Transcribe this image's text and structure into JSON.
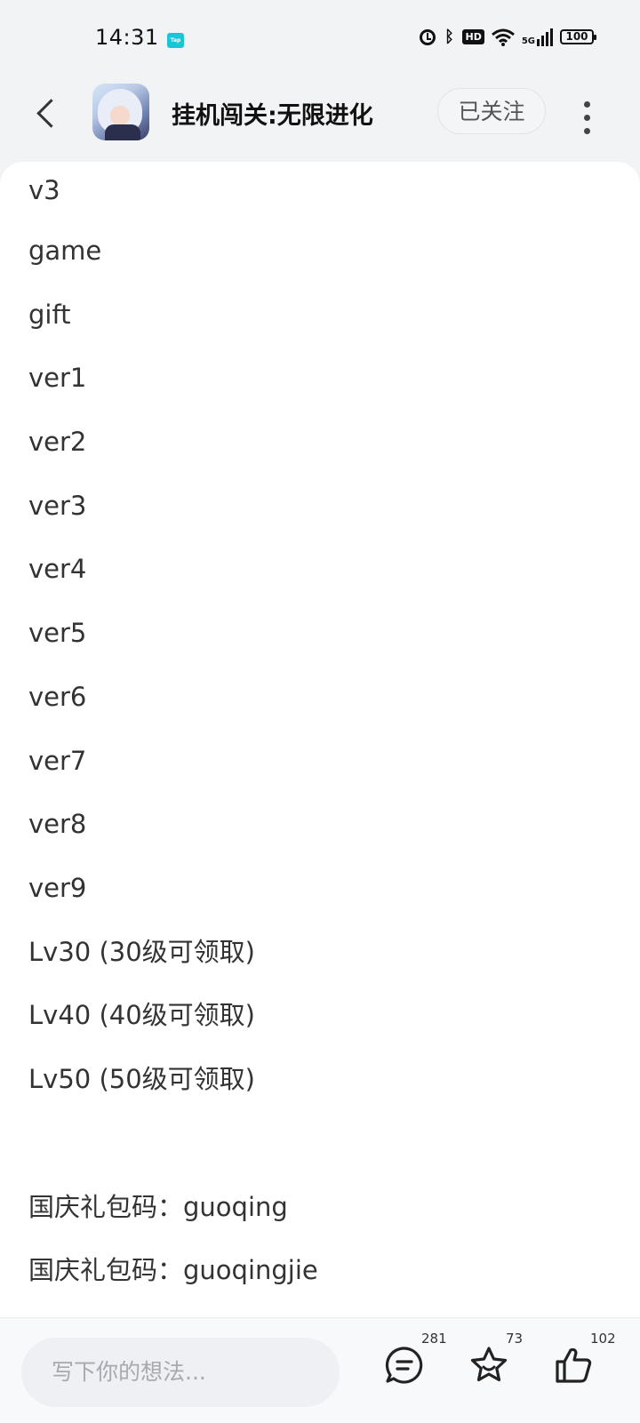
{
  "status_bar": {
    "time": "14:31",
    "tap_label": "Tap",
    "hd_label": "HD",
    "signal_label": "5G",
    "battery": "100"
  },
  "header": {
    "title": "挂机闯关:无限进化",
    "follow_label": "已关注"
  },
  "content": {
    "lines": [
      "v3",
      "game",
      "gift",
      "ver1",
      "ver2",
      "ver3",
      "ver4",
      "ver5",
      "ver6",
      "ver7",
      "ver8",
      "ver9",
      "Lv30 (30级可领取)",
      "Lv40 (40级可领取)",
      "Lv50 (50级可领取)"
    ],
    "codes": [
      "国庆礼包码：guoqing",
      "国庆礼包码：guoqingjie"
    ]
  },
  "bottom_bar": {
    "input_placeholder": "写下你的想法...",
    "comment_count": "281",
    "favorite_count": "73",
    "like_count": "102"
  },
  "colors": {
    "background": "#f2f3f5",
    "content_bg": "#ffffff",
    "text": "#333333",
    "tap_icon": "#19c6d6"
  }
}
